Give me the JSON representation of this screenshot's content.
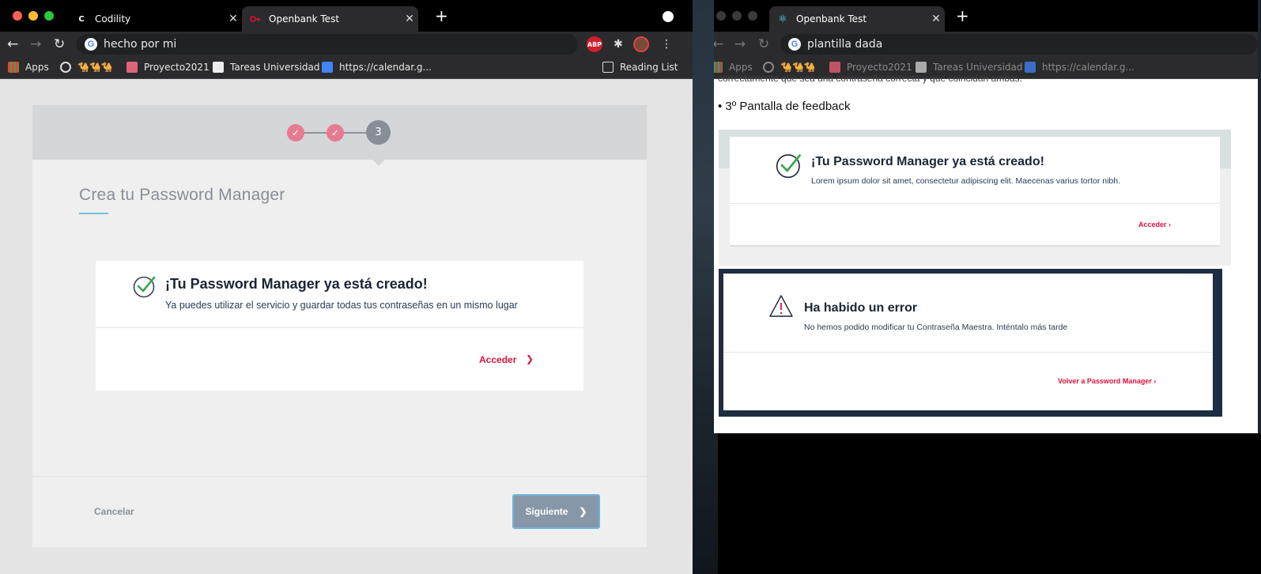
{
  "left_window": {
    "tabs": [
      {
        "title": "Codility",
        "icon": "codility-favicon"
      },
      {
        "title": "Openbank Test",
        "icon": "openbank-favicon"
      }
    ],
    "address": "hecho por mi",
    "extensions": {
      "adblock_label": "ABP"
    },
    "bookmarks": {
      "apps": "Apps",
      "camels": "🐪🐪🐪",
      "proyecto": "Proyecto2021",
      "tareas": "Tareas Universidad",
      "calendar": "https://calendar.g...",
      "reading_list": "Reading List"
    },
    "page": {
      "steps": [
        "✓",
        "✓",
        "3"
      ],
      "title": "Crea tu Password Manager",
      "feedback_title": "¡Tu Password Manager ya está creado!",
      "feedback_text": "Ya puedes utilizar el servicio y guardar todas tus contraseñas en un mismo lugar",
      "access_link": "Acceder",
      "access_chevron": "❯",
      "cancel": "Cancelar",
      "next": "Siguiente",
      "next_chevron": "❯"
    }
  },
  "right_window": {
    "tabs": [
      {
        "title": "Openbank Test",
        "icon": "react-favicon"
      }
    ],
    "address": "plantilla dada",
    "bookmarks": {
      "apps": "Apps",
      "camels": "🐪🐪🐪",
      "proyecto": "Proyecto2021",
      "tareas": "Tareas Universidad",
      "calendar": "https://calendar.g..."
    },
    "page": {
      "cut_text": "correctamente que sea una contraseña correcta y que coincidan ambas.",
      "bullet": "3º Pantalla de feedback",
      "success": {
        "title": "¡Tu Password Manager ya está creado!",
        "text": "Lorem ipsum dolor sit amet, consectetur adipiscing elit. Maecenas varius tortor nibh.",
        "link": "Acceder ›"
      },
      "error": {
        "title": "Ha habido un error",
        "text": "No hemos podido modificar tu Contraseña Maestra. Inténtalo más tarde",
        "link": "Volver a Password Manager ›"
      }
    }
  },
  "colors": {
    "accent_red": "#e0123b",
    "step_done": "#e87a90",
    "step_current": "#888e96",
    "success_green": "#3aa655",
    "navy": "#1e2e42"
  }
}
